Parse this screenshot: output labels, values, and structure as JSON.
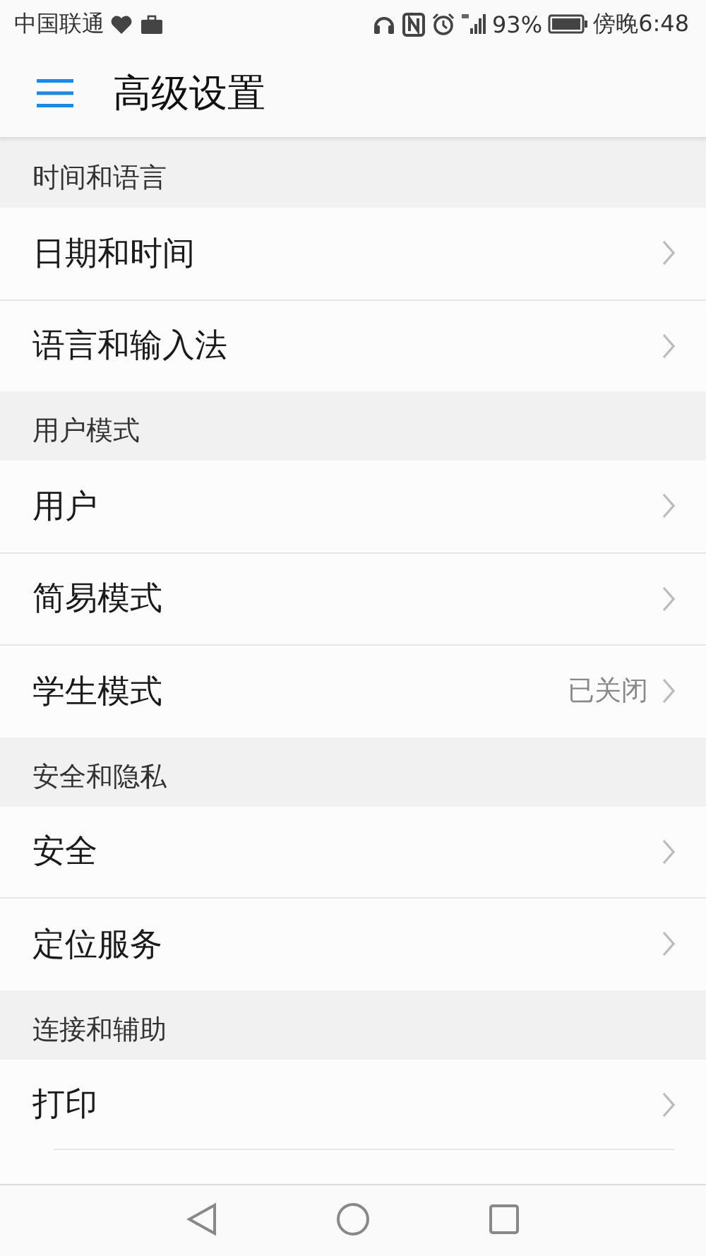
{
  "status_bar": {
    "carrier": "中国联通",
    "battery": "93%",
    "time": "傍晚6:48"
  },
  "header": {
    "title": "高级设置"
  },
  "sections": [
    {
      "title": "时间和语言",
      "items": [
        {
          "label": "日期和时间"
        },
        {
          "label": "语言和输入法"
        }
      ]
    },
    {
      "title": "用户模式",
      "items": [
        {
          "label": "用户"
        },
        {
          "label": "简易模式"
        },
        {
          "label": "学生模式",
          "value": "已关闭"
        }
      ]
    },
    {
      "title": "安全和隐私",
      "items": [
        {
          "label": "安全"
        },
        {
          "label": "定位服务"
        }
      ]
    },
    {
      "title": "连接和辅助",
      "items": [
        {
          "label": "打印"
        }
      ]
    }
  ]
}
